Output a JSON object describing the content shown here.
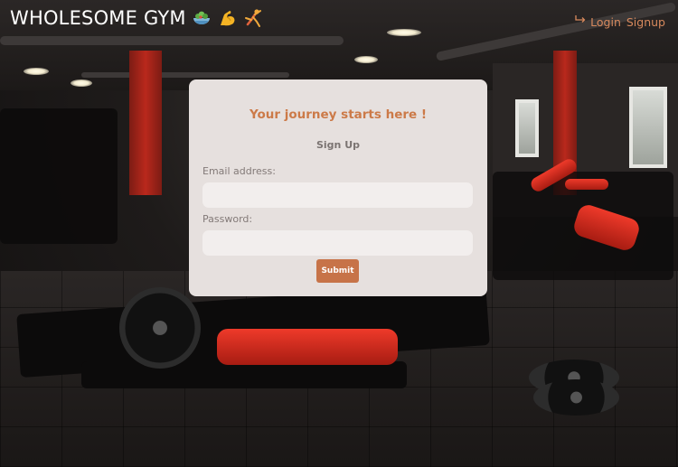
{
  "header": {
    "brand_title": "WHOLESOME GYM",
    "nav": {
      "login_label": "Login",
      "signup_label": "Signup"
    }
  },
  "signup_card": {
    "title": "Your journey starts here !",
    "subtitle": "Sign Up",
    "email_label": "Email address:",
    "email_value": "",
    "password_label": "Password:",
    "password_value": "",
    "submit_label": "Submit"
  },
  "icons": {
    "brand": [
      "salad-bowl-icon",
      "flexed-bicep-icon",
      "gymnast-icon"
    ],
    "login": "login-arrow-icon"
  },
  "colors": {
    "accent": "#cc7a48",
    "card_background": "#e6e0de",
    "input_background": "#f2eeed",
    "header_text": "#ffffff",
    "nav_link": "#d7895d"
  }
}
